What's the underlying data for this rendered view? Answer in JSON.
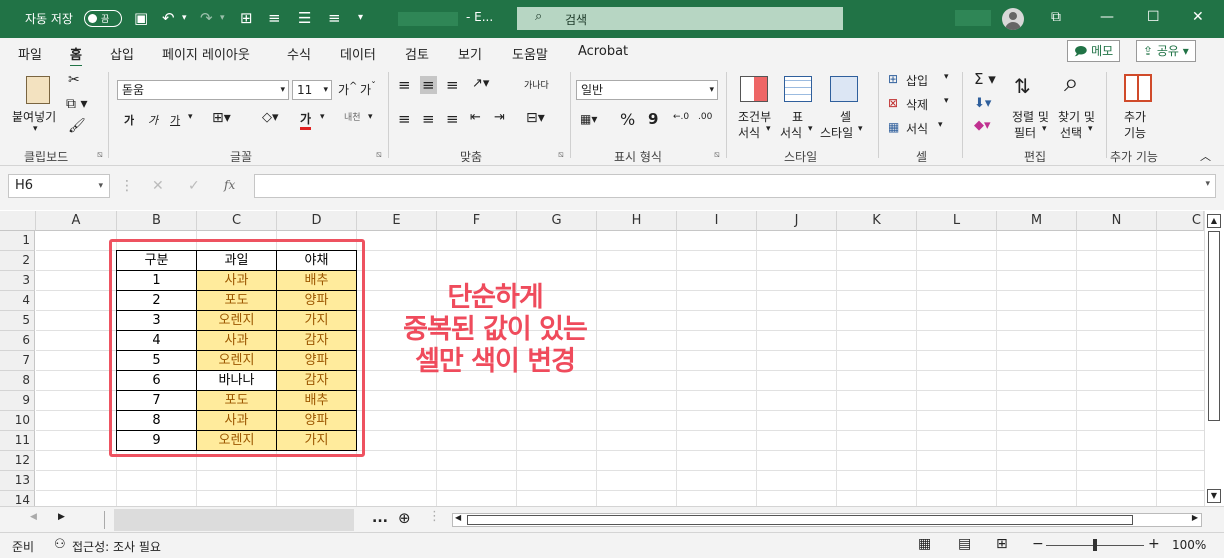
{
  "titlebar": {
    "autosave_label": "자동 저장",
    "autosave_state": "끔",
    "filename_suffix": "- E...",
    "search_placeholder": "검색",
    "color": "#217346"
  },
  "menu": {
    "tabs": [
      "파일",
      "홈",
      "삽입",
      "페이지 레이아웃",
      "수식",
      "데이터",
      "검토",
      "보기",
      "도움말",
      "Acrobat"
    ],
    "active_tab": "홈",
    "memo_button": "메모",
    "share_button": "공유"
  },
  "ribbon": {
    "clipboard": {
      "paste": "붙여넣기",
      "group": "클립보드"
    },
    "font": {
      "name": "돋움",
      "size": "11",
      "bold": "가",
      "italic": "가",
      "underline": "가",
      "font_color": "가",
      "phonetic": "내천",
      "group": "글꼴"
    },
    "alignment": {
      "wrap": "가나다",
      "group": "맞춤"
    },
    "number": {
      "format": "일반",
      "percent": "%",
      "comma": "9",
      "group": "표시 형식"
    },
    "styles": {
      "conditional": [
        "조건부",
        "서식"
      ],
      "table": [
        "표",
        "서식"
      ],
      "cell": [
        "셀",
        "스타일"
      ],
      "group": "스타일"
    },
    "cells": {
      "insert": "삽입",
      "delete": "삭제",
      "format": "서식",
      "group": "셀"
    },
    "editing": {
      "sort": [
        "정렬 및",
        "필터"
      ],
      "find": [
        "찾기 및",
        "선택"
      ],
      "group": "편집"
    },
    "addins": {
      "label": [
        "추가",
        "기능"
      ],
      "group": "추가 기능"
    }
  },
  "formula_bar": {
    "cell_ref": "H6",
    "fx": "fx",
    "value": ""
  },
  "grid": {
    "columns": [
      "A",
      "B",
      "C",
      "D",
      "E",
      "F",
      "G",
      "H",
      "I",
      "J",
      "K",
      "L",
      "M",
      "N",
      "C"
    ],
    "rows": [
      "1",
      "2",
      "3",
      "4",
      "5",
      "6",
      "7",
      "8",
      "9",
      "10",
      "11",
      "12",
      "13",
      "14"
    ],
    "table_header": [
      "구분",
      "과일",
      "야채"
    ],
    "table_rows": [
      {
        "num": "1",
        "fruit": "사과",
        "veg": "배추",
        "fruit_dup": true,
        "veg_dup": true
      },
      {
        "num": "2",
        "fruit": "포도",
        "veg": "양파",
        "fruit_dup": true,
        "veg_dup": true
      },
      {
        "num": "3",
        "fruit": "오렌지",
        "veg": "가지",
        "fruit_dup": true,
        "veg_dup": true
      },
      {
        "num": "4",
        "fruit": "사과",
        "veg": "감자",
        "fruit_dup": true,
        "veg_dup": true
      },
      {
        "num": "5",
        "fruit": "오렌지",
        "veg": "양파",
        "fruit_dup": true,
        "veg_dup": true
      },
      {
        "num": "6",
        "fruit": "바나나",
        "veg": "감자",
        "fruit_dup": false,
        "veg_dup": true
      },
      {
        "num": "7",
        "fruit": "포도",
        "veg": "배추",
        "fruit_dup": true,
        "veg_dup": true
      },
      {
        "num": "8",
        "fruit": "사과",
        "veg": "양파",
        "fruit_dup": true,
        "veg_dup": true
      },
      {
        "num": "9",
        "fruit": "오렌지",
        "veg": "가지",
        "fruit_dup": true,
        "veg_dup": true
      }
    ],
    "duplicate_fill": "#ffeb9c",
    "duplicate_text": "#9c5700"
  },
  "annotation": {
    "lines": [
      "단순하게",
      "중복된 값이 있는",
      "셀만 색이 변경"
    ],
    "color": "#ef4b5c"
  },
  "sheetbar": {
    "more": "..."
  },
  "status": {
    "ready": "준비",
    "accessibility": "접근성: 조사 필요",
    "zoom": "100%"
  }
}
